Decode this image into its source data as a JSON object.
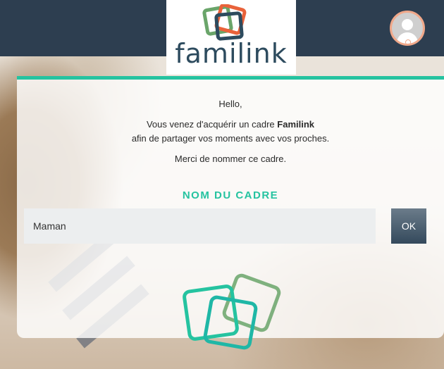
{
  "brand": {
    "name": "familink",
    "colors": {
      "teal": "#25c3a0",
      "green": "#6aa56a",
      "orange": "#e9623a",
      "navy": "#2d3e50"
    }
  },
  "header": {
    "avatar_icon": "user-icon"
  },
  "card": {
    "greeting": "Hello,",
    "line1_prefix": "Vous venez d'acquérir un cadre ",
    "line1_brand": "Familink",
    "line2": "afin de partager vos moments avec vos proches.",
    "line3": "Merci de nommer ce cadre.",
    "frame_name_title": "NOM DU CADRE",
    "frame_name_value": "Maman",
    "ok_label": "OK"
  }
}
